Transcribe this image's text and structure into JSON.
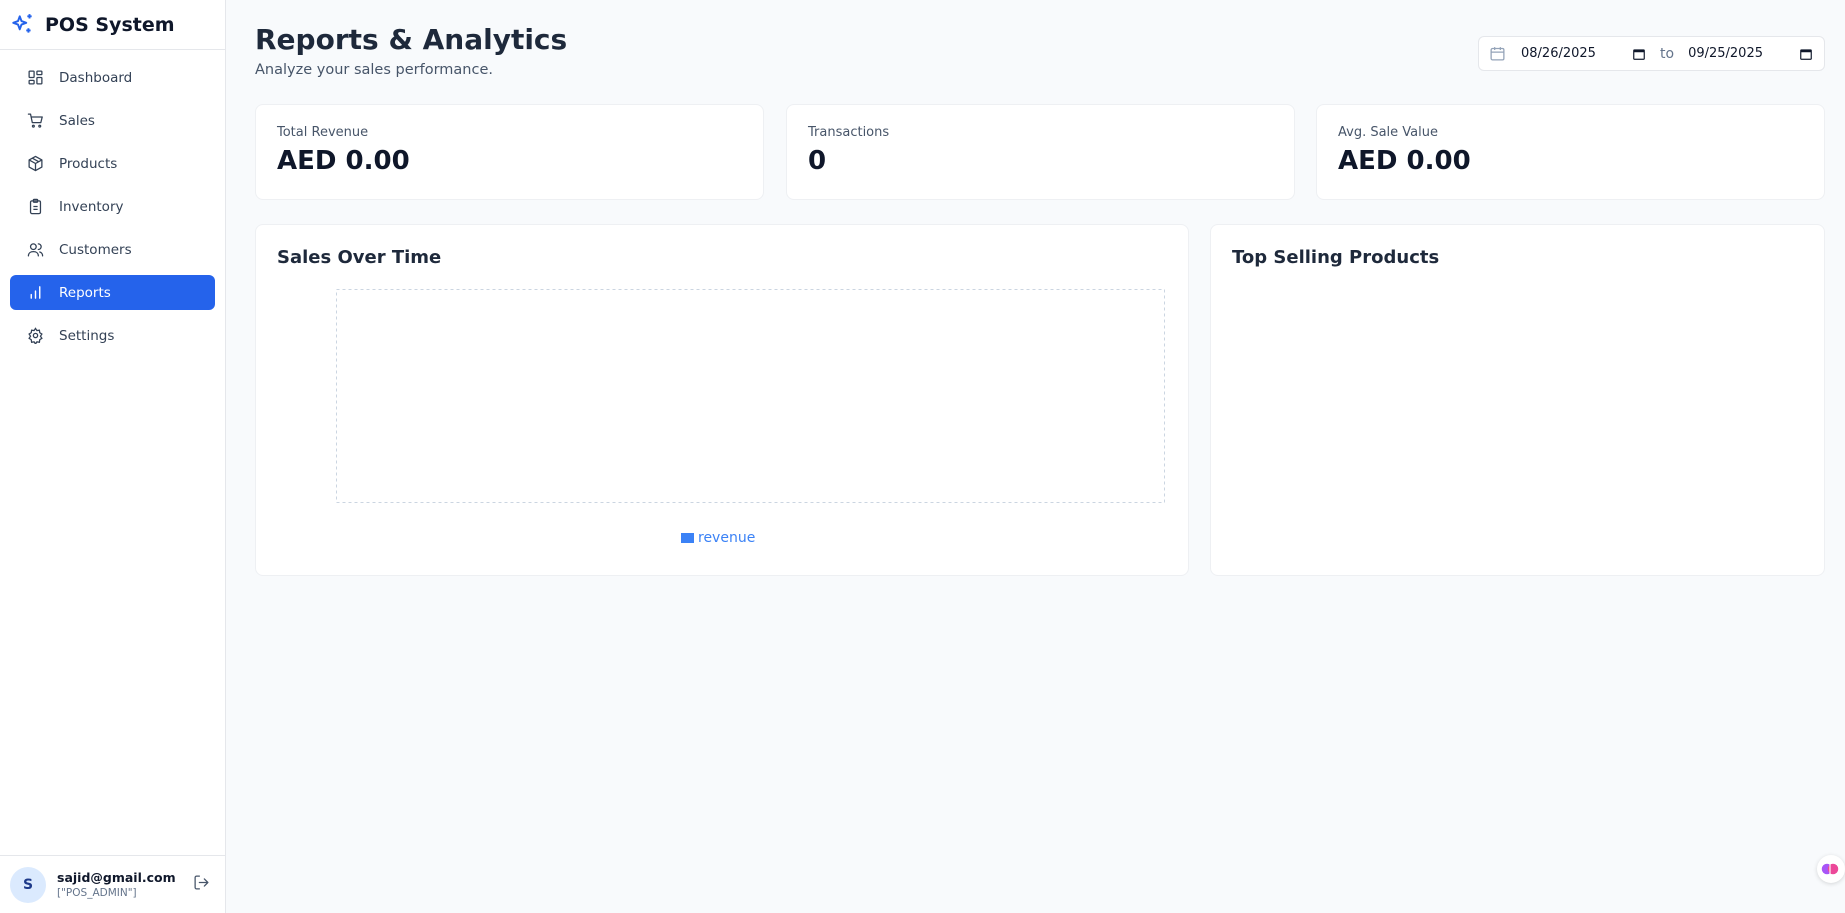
{
  "app": {
    "title": "POS System"
  },
  "sidebar": {
    "items": [
      {
        "label": "Dashboard",
        "icon": "dashboard-icon",
        "active": false
      },
      {
        "label": "Sales",
        "icon": "cart-icon",
        "active": false
      },
      {
        "label": "Products",
        "icon": "box-icon",
        "active": false
      },
      {
        "label": "Inventory",
        "icon": "clipboard-icon",
        "active": false
      },
      {
        "label": "Customers",
        "icon": "users-icon",
        "active": false
      },
      {
        "label": "Reports",
        "icon": "bar-chart-icon",
        "active": true
      },
      {
        "label": "Settings",
        "icon": "gear-icon",
        "active": false
      }
    ]
  },
  "user": {
    "initial": "S",
    "email": "sajid@gmail.com",
    "role": "[\"POS_ADMIN\"]"
  },
  "header": {
    "title": "Reports & Analytics",
    "subtitle": "Analyze your sales performance.",
    "date_from": "08/26/2025",
    "date_to": "09/25/2025",
    "to_label": "to"
  },
  "stats": [
    {
      "label": "Total Revenue",
      "value": "AED 0.00"
    },
    {
      "label": "Transactions",
      "value": "0"
    },
    {
      "label": "Avg. Sale Value",
      "value": "AED 0.00"
    }
  ],
  "panels": {
    "sales_title": "Sales Over Time",
    "top_title": "Top Selling Products"
  },
  "chart_data": {
    "type": "bar",
    "title": "Sales Over Time",
    "categories": [],
    "series": [
      {
        "name": "revenue",
        "values": []
      }
    ],
    "legend": "bottom",
    "grid": true
  },
  "colors": {
    "accent": "#2563eb",
    "series": "#3b82f6"
  }
}
